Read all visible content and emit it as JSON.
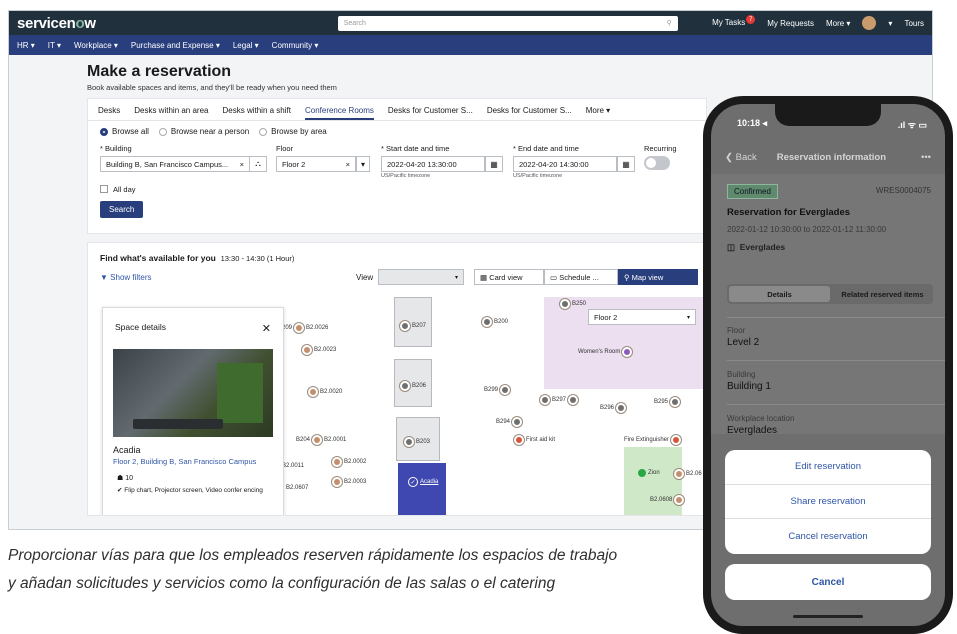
{
  "topbar": {
    "logo_pre": "servicen",
    "logo_o": "o",
    "logo_post": "w",
    "search_placeholder": "Search",
    "my_tasks": "My Tasks",
    "tasks_count": "7",
    "my_requests": "My Requests",
    "more": "More ▾",
    "tours": "Tours"
  },
  "nav": {
    "items": [
      "HR ▾",
      "IT ▾",
      "Workplace ▾",
      "Purchase and Expense ▾",
      "Legal ▾",
      "Community ▾"
    ]
  },
  "page": {
    "title": "Make a reservation",
    "subtitle": "Book available spaces and items, and they'll be ready when you need them"
  },
  "tabs": [
    "Desks",
    "Desks within an area",
    "Desks within a shift",
    "Conference Rooms",
    "Desks for Customer S...",
    "Desks for Customer S...",
    "More ▾"
  ],
  "browse": {
    "all": "Browse all",
    "near": "Browse near a person",
    "area": "Browse by area"
  },
  "form": {
    "building_label": "* Building",
    "building_value": "Building B, San Francisco Campus...",
    "floor_label": "Floor",
    "floor_value": "Floor 2",
    "start_label": "* Start date and time",
    "start_value": "2022-04-20 13:30:00",
    "start_tz": "US/Pacific timezone",
    "end_label": "* End date and time",
    "end_value": "2022-04-20 14:30:00",
    "end_tz": "US/Pacific timezone",
    "recurring_label": "Recurring",
    "allday_label": "All day",
    "search_button": "Search"
  },
  "results": {
    "heading": "Find what's available for you",
    "time": "13:30 - 14:30 (1 Hour)",
    "filters": "Show filters",
    "view_label": "View",
    "card_view": "Card view",
    "schedule": "Schedule ...",
    "map_view": "Map view",
    "map_floor": "Floor 2"
  },
  "map_rooms": [
    "B209",
    "B2.0026",
    "B2.0023",
    "B2.0020",
    "B207",
    "B206",
    "B200",
    "B250",
    "Women's Room",
    "B299",
    "B297",
    "B296",
    "B295",
    "B294",
    "First aid kit",
    "Fire Extinguisher",
    "B204",
    "B2.0001",
    "B203",
    "B2.0011",
    "B2.0002",
    "B2.0003",
    "Acadia",
    "Zion",
    "B2.06",
    "B2.0608",
    "B2.0607"
  ],
  "space": {
    "panel_title": "Space details",
    "name": "Acadia",
    "location": "Floor 2, Building B, San Francisco Campus",
    "capacity": "10",
    "features": "Flip chart, Projector screen, Video confer encing"
  },
  "phone": {
    "time": "10:18 ◂",
    "signal": ".ıl ᯤ ▭",
    "back": "Back",
    "header_title": "Reservation information",
    "status": "Confirmed",
    "res_id": "WRES0004075",
    "res_title": "Reservation for Everglades",
    "res_time": "2022-01-12 10:30:00 to 2022-01-12 11:30:00",
    "room": "Everglades",
    "tab_details": "Details",
    "tab_related": "Related reserved items",
    "floor_label": "Floor",
    "floor_value": "Level 2",
    "building_label": "Building",
    "building_value": "Building 1",
    "location_label": "Workplace location",
    "location_value": "Everglades",
    "actions": [
      "Edit reservation",
      "Share reservation",
      "Cancel reservation"
    ],
    "cancel": "Cancel"
  },
  "caption": "Proporcionar vías para que los empleados reserven rápidamente los espacios de trabajo y añadan solicitudes y servicios como la configuración de las salas o el catering"
}
